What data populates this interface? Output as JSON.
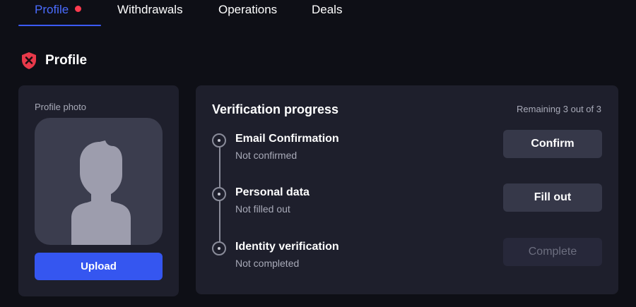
{
  "tabs": [
    {
      "label": "Profile",
      "active": true,
      "has_notification_dot": true
    },
    {
      "label": "Withdrawals",
      "active": false
    },
    {
      "label": "Operations",
      "active": false
    },
    {
      "label": "Deals",
      "active": false
    }
  ],
  "section": {
    "title": "Profile",
    "icon": "shield-x-icon"
  },
  "photo_card": {
    "label": "Profile photo",
    "upload_label": "Upload",
    "avatar_icon": "person-silhouette-icon"
  },
  "verification": {
    "title": "Verification progress",
    "remaining": "Remaining 3 out of 3",
    "steps": [
      {
        "title": "Email Confirmation",
        "status": "Not confirmed",
        "button": "Confirm",
        "button_enabled": true
      },
      {
        "title": "Personal data",
        "status": "Not filled out",
        "button": "Fill out",
        "button_enabled": true
      },
      {
        "title": "Identity verification",
        "status": "Not completed",
        "button": "Complete",
        "button_enabled": false
      }
    ]
  },
  "colors": {
    "background": "#0e0f16",
    "card": "#1e1f2c",
    "accent": "#3556f0",
    "active_tab": "#4a6cff",
    "notification_dot": "#ff3b4f",
    "shield": "#e8394a"
  }
}
